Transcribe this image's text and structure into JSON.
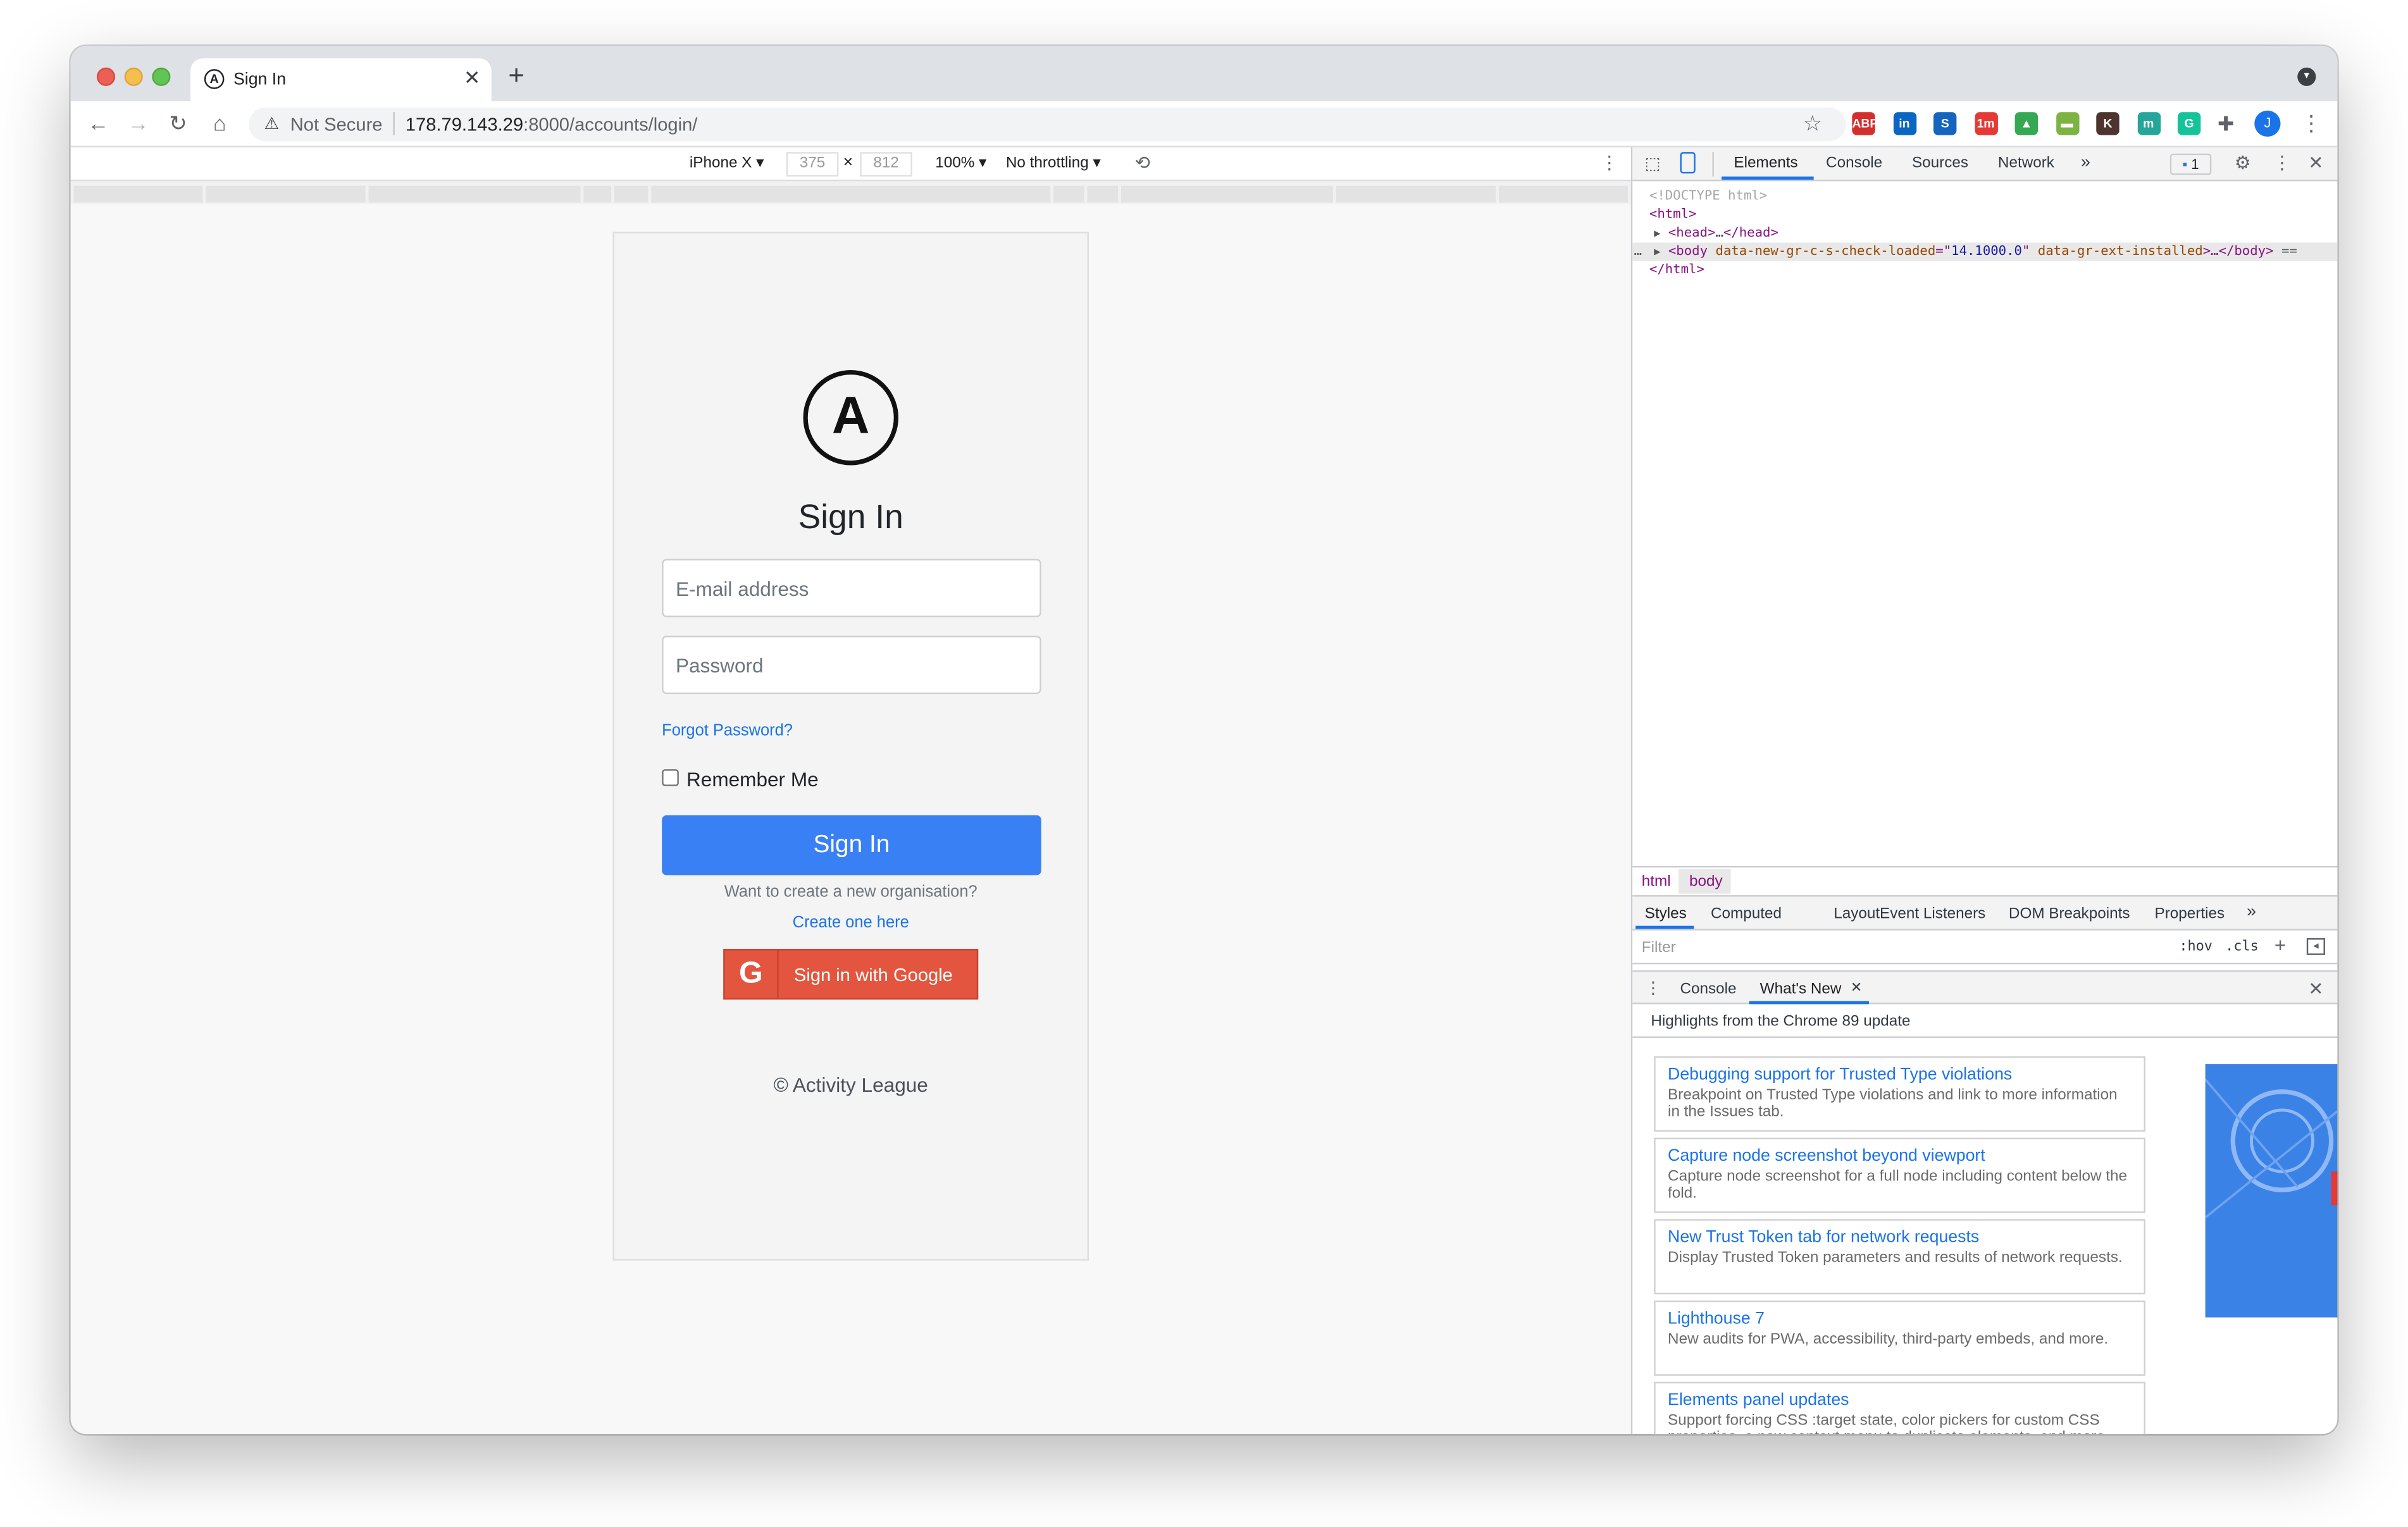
{
  "browser": {
    "tab_title": "Sign In",
    "url_security": "Not Secure",
    "url_host": "178.79.143.29",
    "url_path": ":8000/accounts/login/",
    "extensions": [
      {
        "name": "adblock-plus-icon",
        "label": "ABP",
        "color": "#d32f2f"
      },
      {
        "name": "linkedin-icon",
        "label": "in",
        "color": "#0a66c2"
      },
      {
        "name": "s-extension-icon",
        "label": "S",
        "color": "#1565c0"
      },
      {
        "name": "timer-extension-icon",
        "label": "1m",
        "color": "#e53935"
      },
      {
        "name": "google-drive-icon",
        "label": "▲",
        "color": "#34a853"
      },
      {
        "name": "folder-extension-icon",
        "label": "▬",
        "color": "#7cb342"
      },
      {
        "name": "k-extension-icon",
        "label": "K",
        "color": "#4e342e"
      },
      {
        "name": "m-extension-icon",
        "label": "m",
        "color": "#26a69a"
      },
      {
        "name": "grammarly-icon",
        "label": "G",
        "color": "#15c39a"
      }
    ],
    "profile_initial": "J"
  },
  "device_toolbar": {
    "device": "iPhone X",
    "width": "375",
    "height": "812",
    "zoom": "100%",
    "throttling": "No throttling"
  },
  "page": {
    "logo_letter": "A",
    "title": "Sign In",
    "email_placeholder": "E-mail address",
    "password_placeholder": "Password",
    "forgot_password": "Forgot Password?",
    "remember_me": "Remember Me",
    "sign_in_button": "Sign In",
    "create_prompt": "Want to create a new organisation?",
    "create_link": "Create one here",
    "google_button": "Sign in with Google",
    "footer": "© Activity League",
    "colors": {
      "primary": "#3a80f5",
      "google": "#e4553f",
      "link": "#1a73e8"
    }
  },
  "devtools": {
    "tabs": [
      "Elements",
      "Console",
      "Sources",
      "Network"
    ],
    "active_tab": "Elements",
    "issues_badge": "1",
    "dom": {
      "doctype": "<!DOCTYPE html>",
      "html_open": "<html>",
      "head_tag_open": "<head>",
      "head_ellipsis": "…",
      "head_tag_close": "</head>",
      "body_tag": "<body",
      "body_attr1_name": "data-new-gr-c-s-check-loaded",
      "body_attr1_value": "14.1000.0",
      "body_attr2_name": "data-gr-ext-installed",
      "body_close": ">…</body>",
      "body_marker": "==",
      "html_close": "</html>"
    },
    "breadcrumbs": [
      "html",
      "body"
    ],
    "style_tabs": [
      "Styles",
      "Computed",
      "Layout",
      "Event Listeners",
      "DOM Breakpoints",
      "Properties"
    ],
    "filter_placeholder": "Filter",
    "hov": ":hov",
    "cls": ".cls",
    "drawer_tabs": [
      "Console",
      "What's New"
    ],
    "whats_new_heading": "Highlights from the Chrome 89 update",
    "features": [
      {
        "title": "Debugging support for Trusted Type violations",
        "description": "Breakpoint on Trusted Type violations and link to more information in the Issues tab."
      },
      {
        "title": "Capture node screenshot beyond viewport",
        "description": "Capture node screenshot for a full node including content below the fold."
      },
      {
        "title": "New Trust Token tab for network requests",
        "description": "Display Trusted Token parameters and results of network requests."
      },
      {
        "title": "Lighthouse 7",
        "description": "New audits for PWA, accessibility, third-party embeds, and more."
      },
      {
        "title": "Elements panel updates",
        "description": "Support forcing CSS :target state, color pickers for custom CSS properties, a new context menu to duplicate elements, and more."
      }
    ]
  }
}
